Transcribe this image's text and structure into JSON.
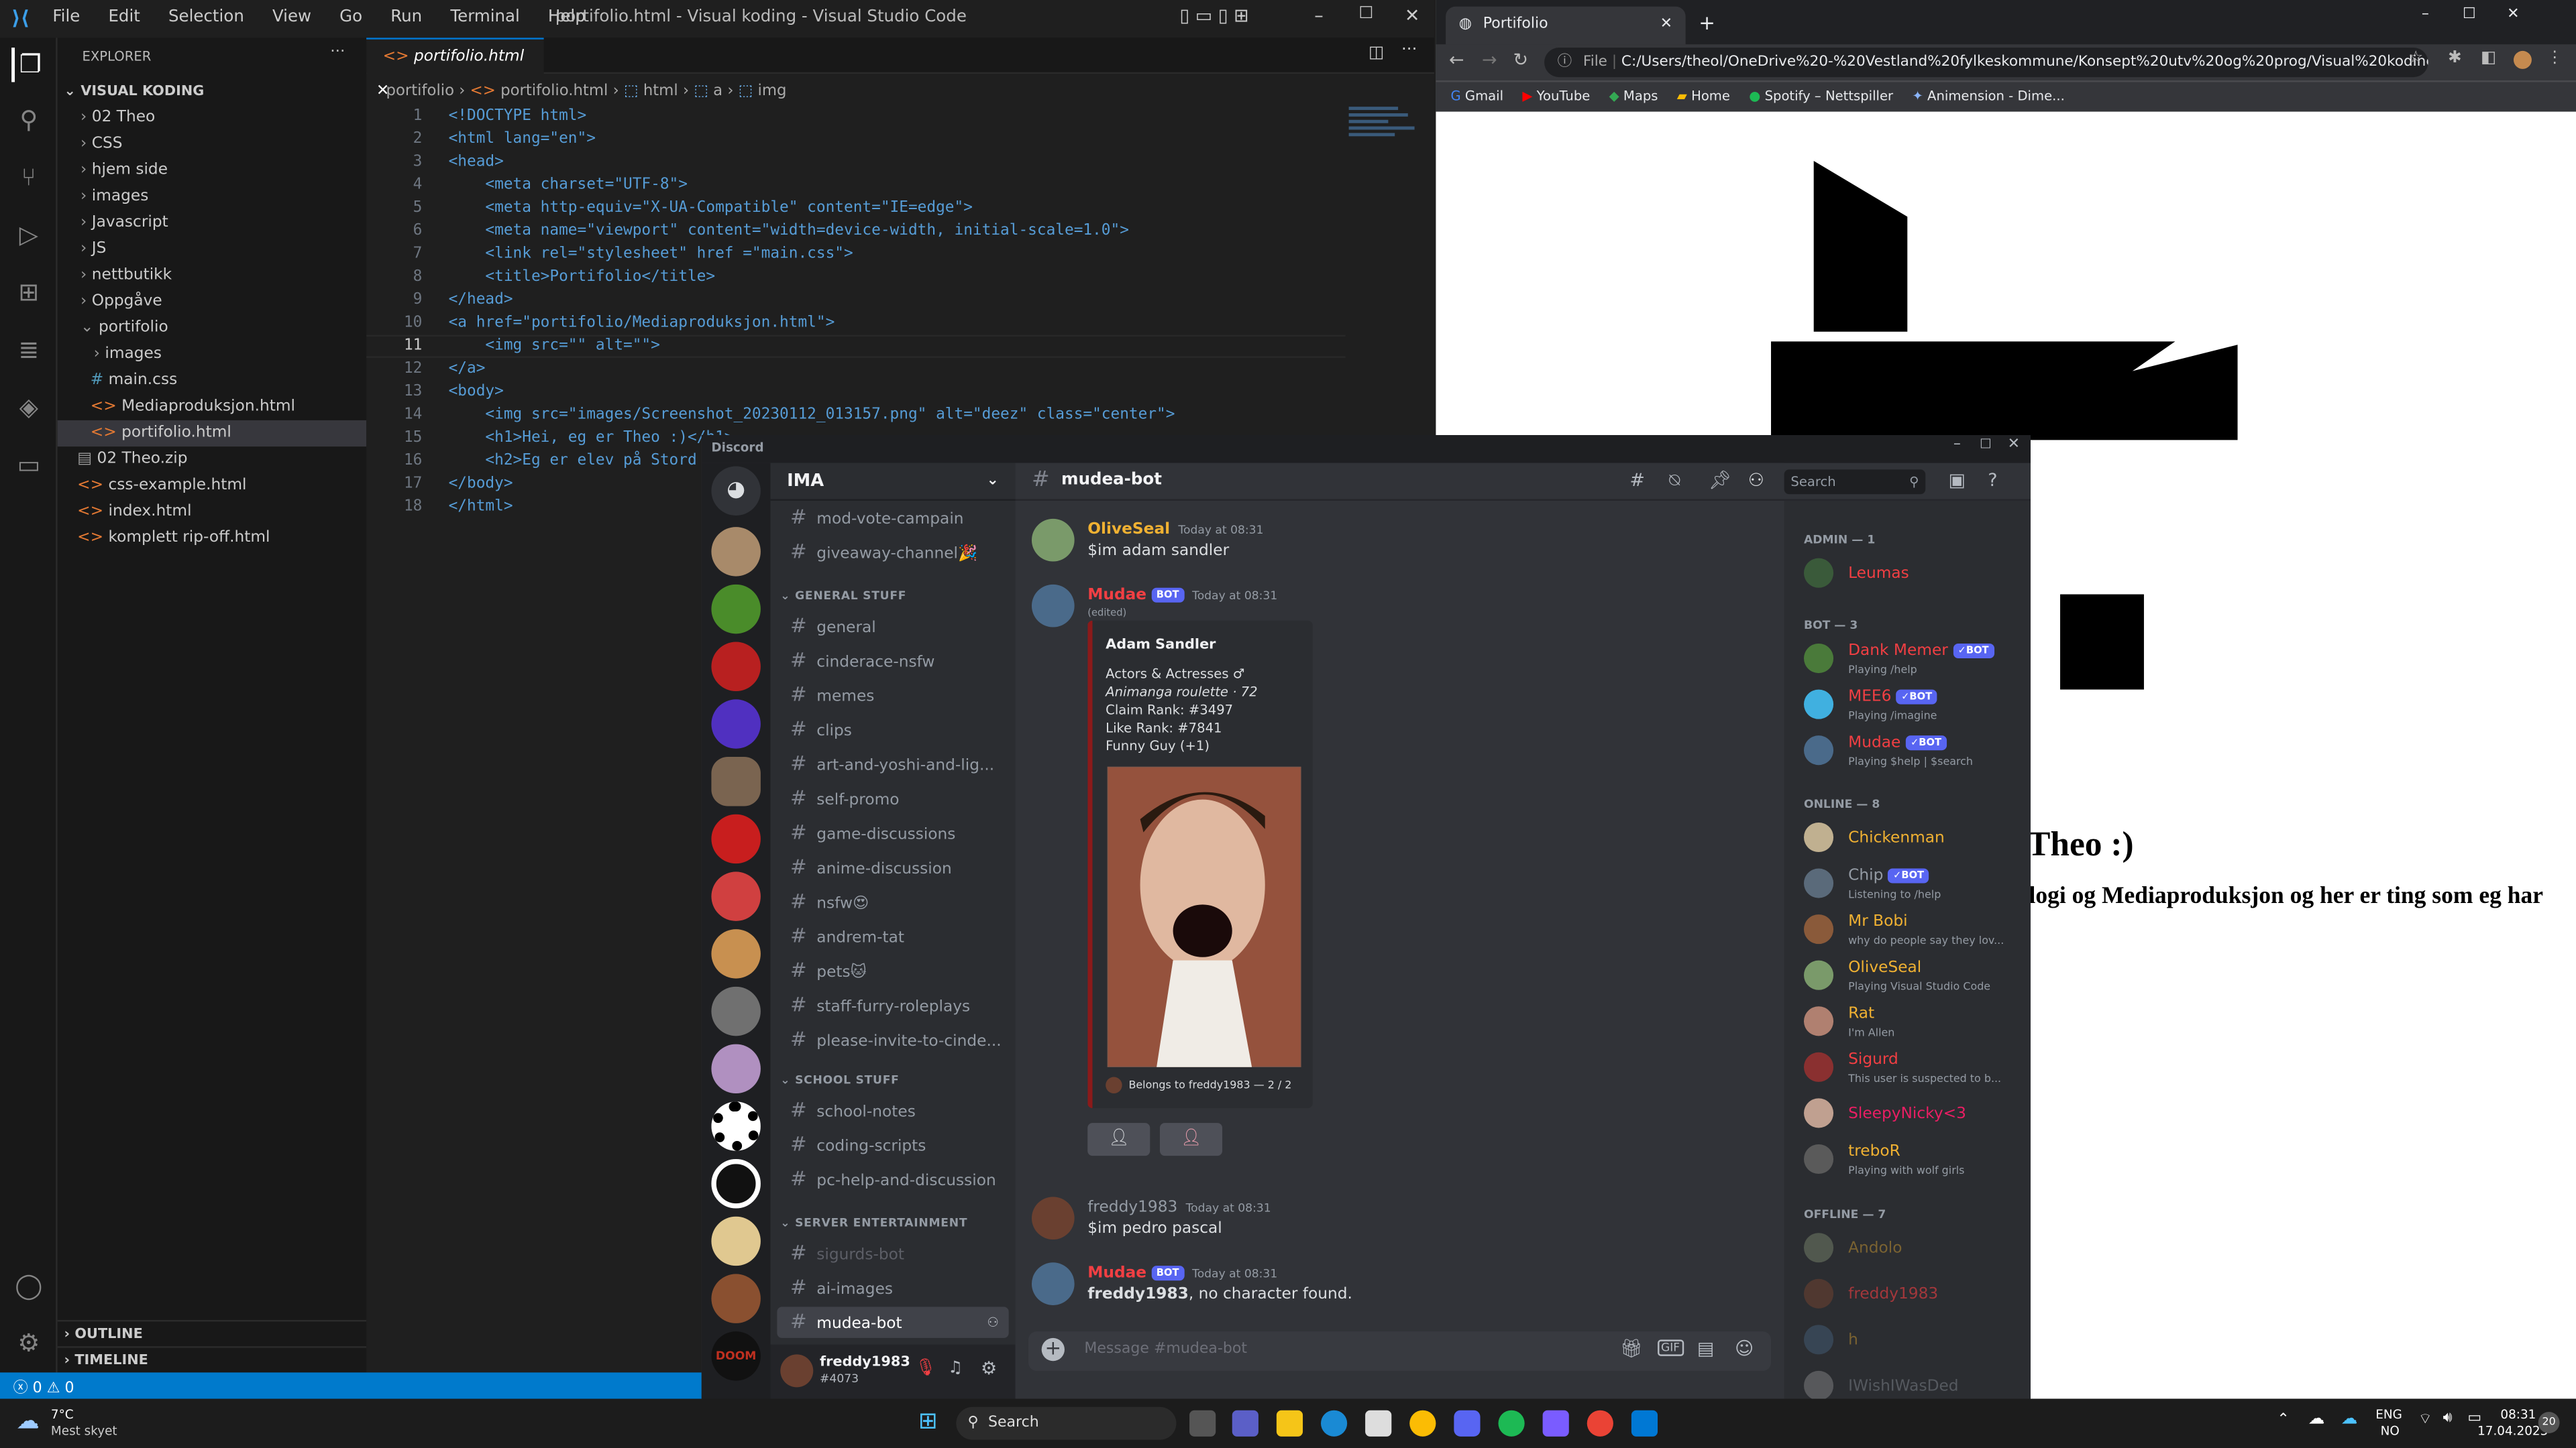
{
  "vscode": {
    "title": "portifolio.html - Visual koding - Visual Studio Code",
    "menu": [
      "File",
      "Edit",
      "Selection",
      "View",
      "Go",
      "Run",
      "Terminal",
      "Help"
    ],
    "explorer_label": "EXPLORER",
    "root_folder": "VISUAL KODING",
    "tree": [
      "02 Theo",
      "CSS",
      "hjem side",
      "images",
      "Javascript",
      "JS",
      "nettbutikk",
      "Oppgåve",
      "portifolio",
      "images",
      "main.css",
      "Mediaproduksjon.html",
      "portifolio.html",
      "02 Theo.zip",
      "css-example.html",
      "index.html",
      "komplett rip-off.html"
    ],
    "outline": "OUTLINE",
    "timeline": "TIMELINE",
    "tab": "portifolio.html",
    "breadcrumb": [
      "portifolio",
      "portifolio.html",
      "html",
      "a",
      "img"
    ],
    "line_numbers": [
      "1",
      "2",
      "3",
      "4",
      "5",
      "6",
      "7",
      "8",
      "9",
      "10",
      "11",
      "12",
      "13",
      "14",
      "15",
      "16",
      "17",
      "18"
    ],
    "code": [
      "<!DOCTYPE html>",
      "<html lang=\"en\">",
      "<head>",
      "    <meta charset=\"UTF-8\">",
      "    <meta http-equiv=\"X-UA-Compatible\" content=\"IE=edge\">",
      "    <meta name=\"viewport\" content=\"width=device-width, initial-scale=1.0\">",
      "    <link rel=\"stylesheet\" href =\"main.css\">",
      "    <title>Portifolio</title>",
      "</head>",
      "<a href=\"portifolio/Mediaproduksjon.html\">",
      "    <img src=\"\" alt=\"\">",
      "</a>",
      "<body>",
      "    <img src=\"images/Screenshot_20230112_013157.png\" alt=\"deez\" class=\"center\">",
      "    <h1>Hei, eg er Theo :)</h1>",
      "    <h2>Eg er elev på Stord",
      "</body>",
      "</html>"
    ],
    "status_errors": "0",
    "status_warnings": "0"
  },
  "chrome": {
    "tab_title": "Portifolio",
    "address": "C:/Users/theol/OneDrive%20-%20Vestland%20fylkeskommune/Konsept%20utv%20og%20prog/Visual%20koding/porti...",
    "file_label": "File",
    "bookmarks": [
      "Gmail",
      "YouTube",
      "Maps",
      "Home",
      "Spotify – Nettspiller",
      "Animension - Dime..."
    ],
    "page_h1": "Theo :)",
    "page_h2": "logi og Mediaproduksjon og her er ting som eg har"
  },
  "discord": {
    "app_label": "Discord",
    "server": "IMA",
    "channels_top": [
      "mod-vote-campain",
      "giveaway-channel🎉"
    ],
    "cat_general": "GENERAL STUFF",
    "channels_general": [
      "general",
      "cinderace-nsfw",
      "memes",
      "clips",
      "art-and-yoshi-and-lig...",
      "self-promo",
      "game-discussions",
      "anime-discussion",
      "nsfw😍",
      "andrem-tat",
      "pets🐱",
      "staff-furry-roleplays",
      "please-invite-to-cinde..."
    ],
    "cat_school": "SCHOOL STUFF",
    "channels_school": [
      "school-notes",
      "coding-scripts",
      "pc-help-and-discussion"
    ],
    "cat_server": "SERVER ENTERTAINMENT",
    "channels_server": [
      "sigurds-bot",
      "ai-images",
      "mudea-bot"
    ],
    "current_channel": "mudea-bot",
    "search_placeholder": "Search",
    "user": {
      "name": "freddy1983",
      "tag": "#4073"
    },
    "messages": {
      "m1": {
        "author": "OliveSeal",
        "time": "Today at 08:31",
        "text": "$im adam sandler"
      },
      "m2": {
        "author": "Mudae",
        "badge": "BOT",
        "time": "Today at 08:31",
        "edited": "(edited)",
        "embed": {
          "title": "Adam Sandler",
          "line1": "Actors & Actresses ♂",
          "line2": "Animanga roulette · 72",
          "line3": "Claim Rank: #3497",
          "line4": "Like Rank: #7841",
          "line5": "Funny Guy (+1)",
          "footer": "Belongs to freddy1983 — 2 / 2"
        }
      },
      "m3": {
        "author": "freddy1983",
        "time": "Today at 08:31",
        "text": "$im pedro pascal"
      },
      "m4": {
        "author": "Mudae",
        "badge": "BOT",
        "time": "Today at 08:31",
        "bold": "freddy1983",
        "text": ", no character found."
      }
    },
    "composer_placeholder": "Message #mudea-bot",
    "members": {
      "admin_header": "ADMIN — 1",
      "admin": [
        {
          "name": "Leumas",
          "color": "#f23f43"
        }
      ],
      "bot_header": "BOT — 3",
      "bots": [
        {
          "name": "Dank Memer",
          "status": "Playing /help",
          "color": "#f23f43"
        },
        {
          "name": "MEE6",
          "status": "Playing /imagine",
          "color": "#f23f43"
        },
        {
          "name": "Mudae",
          "status": "Playing $help | $search",
          "color": "#f23f43"
        }
      ],
      "online_header": "ONLINE — 8",
      "online": [
        {
          "name": "Chickenman",
          "status": "",
          "color": "#f0b132"
        },
        {
          "name": "Chip",
          "status": "Listening to /help",
          "color": "#949ba4"
        },
        {
          "name": "Mr Bobi",
          "status": "why do people say they lov...",
          "color": "#f0b132"
        },
        {
          "name": "OliveSeal",
          "status": "Playing Visual Studio Code",
          "color": "#f0b132"
        },
        {
          "name": "Rat",
          "status": "I'm Allen",
          "color": "#f0b132"
        },
        {
          "name": "Sigurd",
          "status": "This user is suspected to b...",
          "color": "#f23f43"
        },
        {
          "name": "SleepyNicky<3",
          "status": "",
          "color": "#e91e63"
        },
        {
          "name": "treboR",
          "status": "Playing with wolf girls",
          "color": "#f0b132"
        }
      ],
      "offline_header": "OFFLINE — 7",
      "offline": [
        {
          "name": "Andolo",
          "color": "#f0b132"
        },
        {
          "name": "freddy1983",
          "color": "#f23f43"
        },
        {
          "name": "h",
          "color": "#f0b132"
        },
        {
          "name": "IWishIWasDed",
          "color": "#949ba4"
        }
      ]
    }
  },
  "taskbar": {
    "weather_temp": "7°C",
    "weather_desc": "Mest skyet",
    "search": "Search",
    "lang1": "ENG",
    "lang2": "NO",
    "time": "08:31",
    "date": "17.04.2023",
    "notif_count": "20"
  }
}
